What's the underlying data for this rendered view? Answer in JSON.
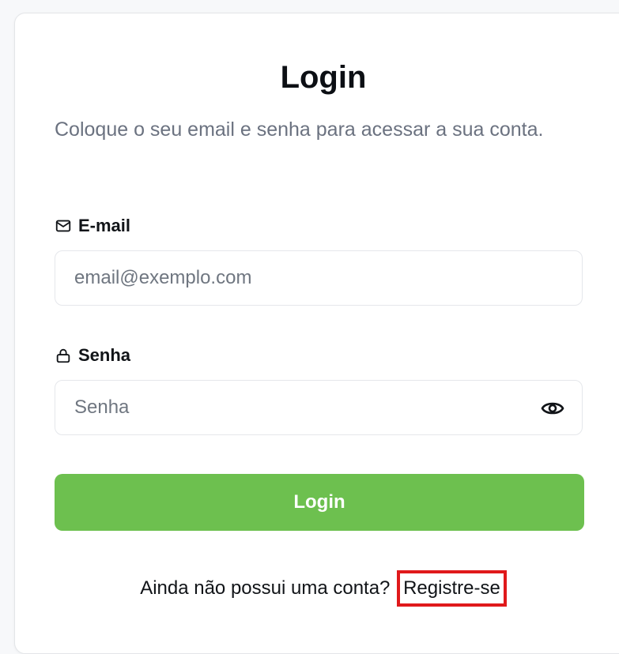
{
  "login": {
    "title": "Login",
    "subtitle": "Coloque o seu email e senha para acessar a sua conta.",
    "email": {
      "label": "E-mail",
      "icon": "mail-icon",
      "placeholder": "email@exemplo.com"
    },
    "password": {
      "label": "Senha",
      "icon": "lock-icon",
      "placeholder": "Senha",
      "toggle_icon": "eye-icon"
    },
    "submit_label": "Login",
    "footer": {
      "prompt": "Ainda não possui uma conta?",
      "register_label": "Registre-se"
    }
  },
  "colors": {
    "primary_button": "#6dc04f",
    "highlight_border": "#e0191b",
    "subtitle_text": "#6b7280"
  }
}
